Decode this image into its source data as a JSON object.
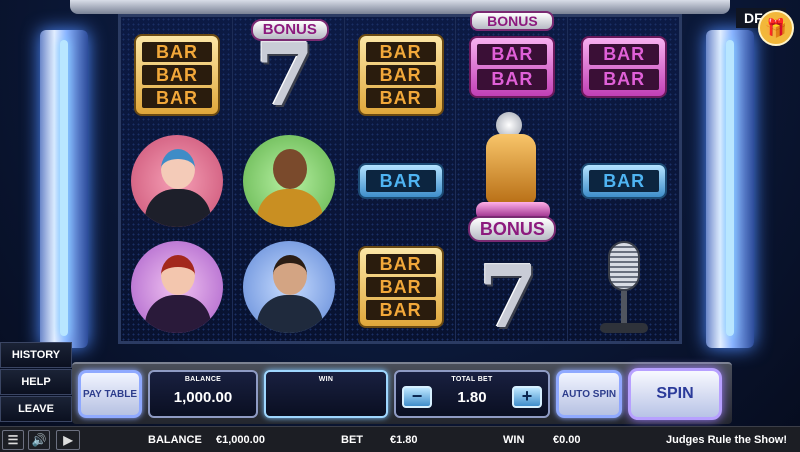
{
  "top_right": {
    "badge_text": "DF",
    "gift_icon": "gift-icon"
  },
  "reels": [
    {
      "symbols": [
        "BAR BAR BAR",
        "avatar-woman-blue-hair",
        "avatar-woman-red-hair"
      ]
    },
    {
      "symbols": [
        "BONUS 7",
        "avatar-man-gold-jacket",
        "avatar-man-beard"
      ]
    },
    {
      "symbols": [
        "BAR BAR BAR",
        "BAR",
        "BAR BAR BAR"
      ]
    },
    {
      "symbols": [
        "BONUS",
        "BAR BAR",
        "golden-mic-trophy-BONUS",
        "BONUS 7"
      ]
    },
    {
      "symbols": [
        "BAR BAR",
        "BAR",
        "studio-microphone"
      ]
    }
  ],
  "labels": {
    "bar": "BAR",
    "bonus": "BONUS",
    "seven": "7"
  },
  "left_menu": {
    "history": "HISTORY",
    "help": "HELP",
    "leave": "LEAVE"
  },
  "controls": {
    "paytable": "PAY TABLE",
    "balance_label": "BALANCE",
    "balance_value": "1,000.00",
    "win_label": "WIN",
    "win_value": "",
    "total_bet_label": "TOTAL BET",
    "total_bet_value": "1.80",
    "minus": "−",
    "plus": "+",
    "auto_spin": "AUTO SPIN",
    "spin": "SPIN"
  },
  "status_bar": {
    "balance_label": "BALANCE",
    "balance_value": "€1,000.00",
    "bet_label": "BET",
    "bet_value": "€1.80",
    "win_label": "WIN",
    "win_value": "€0.00",
    "game_title": "Judges Rule the Show!"
  }
}
